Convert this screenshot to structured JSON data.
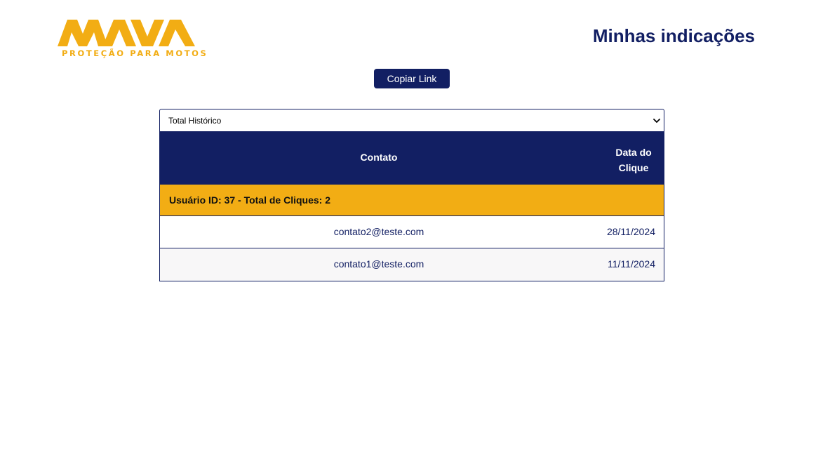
{
  "brand": {
    "name": "MAVA",
    "tagline": "PROTEÇÃO PARA MOTOS"
  },
  "header": {
    "title": "Minhas indicações"
  },
  "actions": {
    "copy_link_label": "Copiar Link"
  },
  "filter": {
    "selected": "Total Histórico"
  },
  "table": {
    "columns": [
      "Contato",
      "Data do Clique"
    ],
    "groups": [
      {
        "label": "Usuário ID: 37 - Total de Cliques: 2",
        "rows": [
          {
            "contact": "contato2@teste.com",
            "date": "28/11/2024"
          },
          {
            "contact": "contato1@teste.com",
            "date": "11/11/2024"
          }
        ]
      }
    ]
  },
  "colors": {
    "primary": "#121f63",
    "accent": "#f2ad14",
    "row_alt": "#f8f7f8"
  }
}
